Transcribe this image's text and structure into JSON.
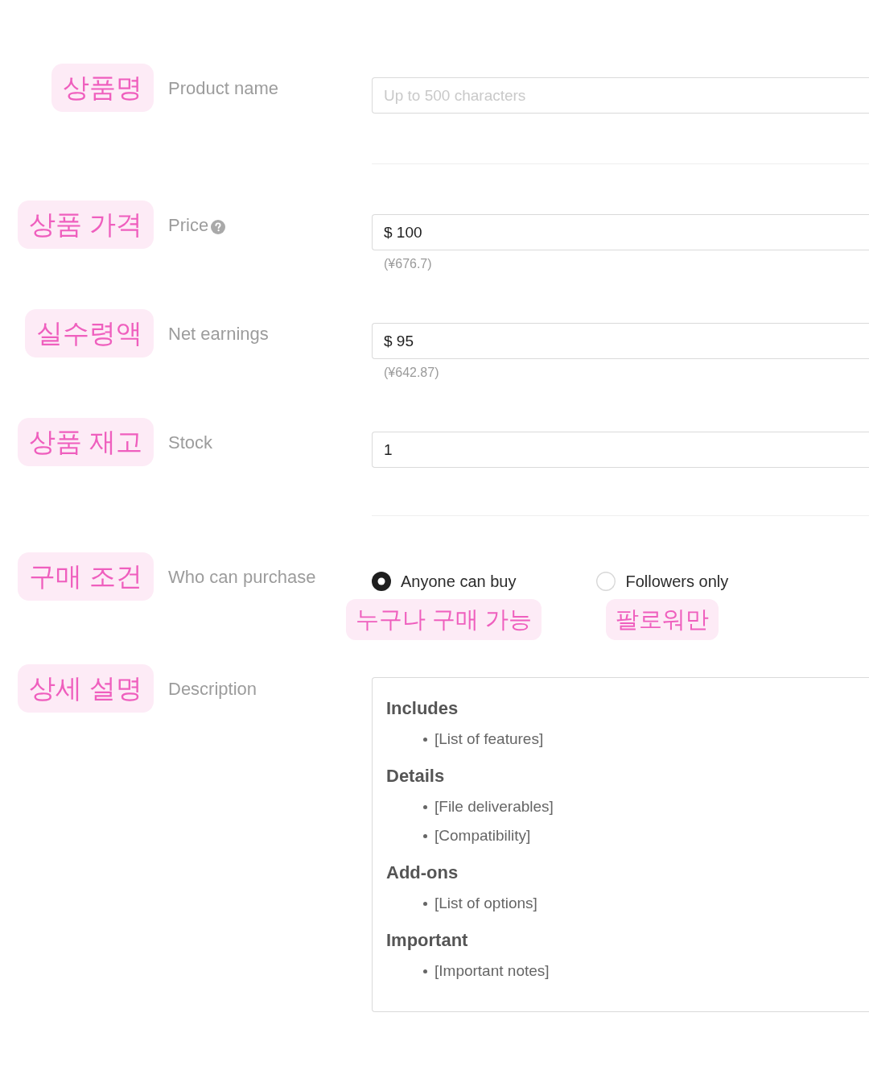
{
  "sections": [
    {
      "fields": [
        {
          "kind": "text",
          "annotation": "상품명",
          "label": "Product name",
          "placeholder": "Up to 500 characters"
        }
      ]
    },
    {
      "fields": [
        {
          "kind": "text",
          "annotation": "상품 가격",
          "label": "Price",
          "help": true,
          "value": "$ 100",
          "note": "(¥676.7)"
        },
        {
          "kind": "text",
          "annotation": "실수령액",
          "label": "Net earnings",
          "value": "$ 95",
          "note": "(¥642.87)"
        },
        {
          "kind": "text",
          "annotation": "상품 재고",
          "label": "Stock",
          "value": "1"
        }
      ]
    },
    {
      "fields": [
        {
          "kind": "radio",
          "annotation": "구매 조건",
          "label": "Who can purchase",
          "options": [
            {
              "label": "Anyone can buy",
              "annotation": "누구나 구매 가능",
              "selected": true
            },
            {
              "label": "Followers only",
              "annotation": "팔로워만",
              "selected": false
            }
          ]
        },
        {
          "kind": "textarea",
          "annotation": "상세 설명",
          "label": "Description",
          "content": [
            {
              "heading": "Includes",
              "items": [
                "[List of features]"
              ]
            },
            {
              "heading": "Details",
              "items": [
                "[File deliverables]",
                "[Compatibility]"
              ]
            },
            {
              "heading": "Add-ons",
              "items": [
                "[List of options]"
              ]
            },
            {
              "heading": "Important",
              "items": [
                "[Important notes]"
              ]
            }
          ]
        }
      ]
    }
  ]
}
